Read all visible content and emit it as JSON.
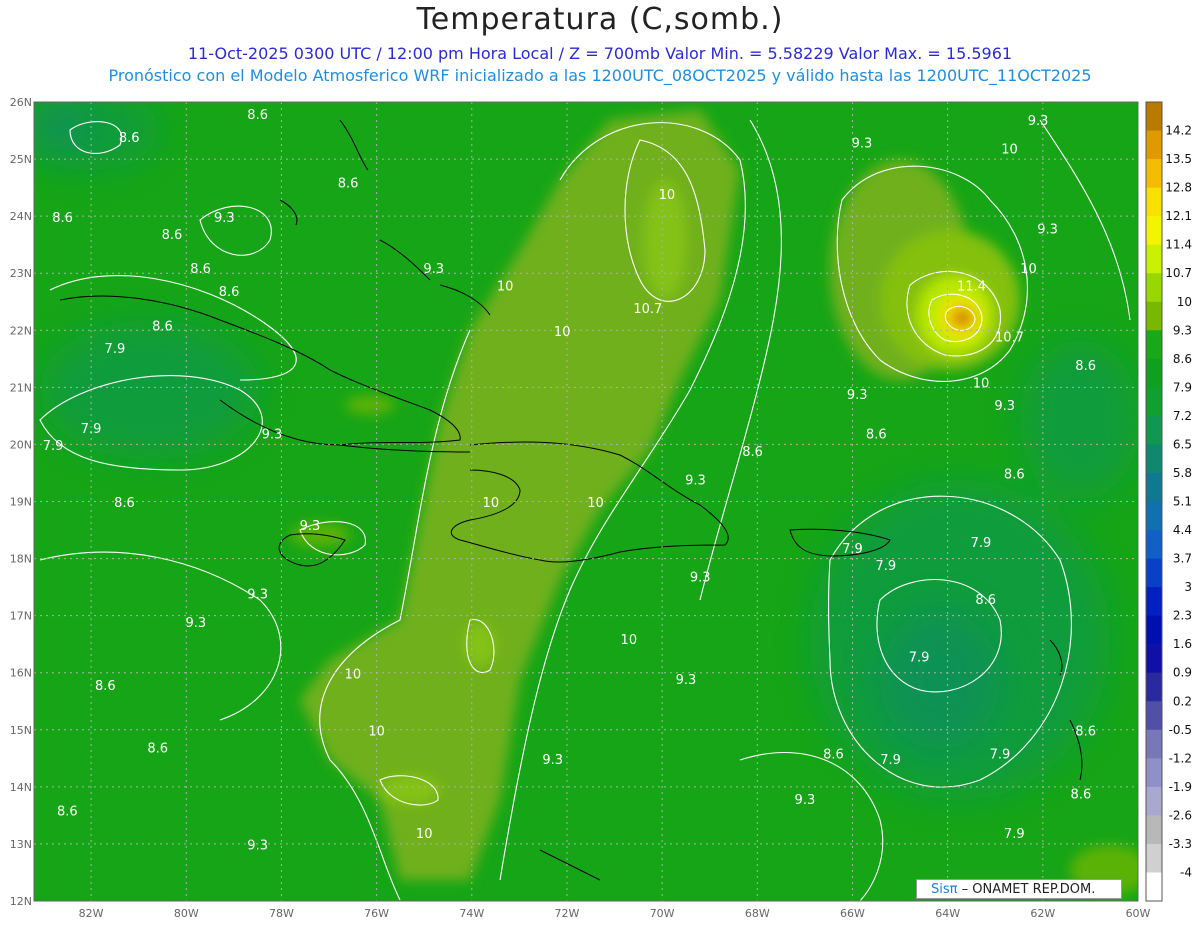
{
  "header": {
    "title": "Temperatura (C,somb.)",
    "line1": "11-Oct-2025  0300 UTC / 12:00 pm Hora Local / Z = 700mb   Valor Min. = 5.58229  Valor Max. = 15.5961",
    "line2": "Pronóstico con el Modelo Atmosferico WRF inicializado a las 1200UTC_08OCT2025 y válido hasta las  1200UTC_11OCT2025"
  },
  "map": {
    "lon_range": [
      -83.2,
      -60
    ],
    "lat_range": [
      12,
      26
    ],
    "lon_ticks": [
      "82W",
      "80W",
      "78W",
      "76W",
      "74W",
      "72W",
      "70W",
      "68W",
      "66W",
      "64W",
      "62W",
      "60W"
    ],
    "lat_ticks": [
      "12N",
      "13N",
      "14N",
      "15N",
      "16N",
      "17N",
      "18N",
      "19N",
      "20N",
      "21N",
      "22N",
      "23N",
      "24N",
      "25N",
      "26N"
    ],
    "contour_labels": [
      {
        "t": "8.6",
        "lon": -81.2,
        "lat": 25.3
      },
      {
        "t": "8.6",
        "lon": -78.5,
        "lat": 25.7
      },
      {
        "t": "8.6",
        "lon": -76.6,
        "lat": 24.5
      },
      {
        "t": "8.6",
        "lon": -82.6,
        "lat": 23.9
      },
      {
        "t": "8.6",
        "lon": -80.3,
        "lat": 23.6
      },
      {
        "t": "9.3",
        "lon": -79.2,
        "lat": 23.9
      },
      {
        "t": "8.6",
        "lon": -79.7,
        "lat": 23.0
      },
      {
        "t": "8.6",
        "lon": -79.1,
        "lat": 22.6
      },
      {
        "t": "8.6",
        "lon": -80.5,
        "lat": 22.0
      },
      {
        "t": "7.9",
        "lon": -81.5,
        "lat": 21.6
      },
      {
        "t": "7.9",
        "lon": -82.0,
        "lat": 20.2
      },
      {
        "t": "7.9",
        "lon": -82.8,
        "lat": 19.9
      },
      {
        "t": "9.3",
        "lon": -78.2,
        "lat": 20.1
      },
      {
        "t": "8.6",
        "lon": -81.3,
        "lat": 18.9
      },
      {
        "t": "9.3",
        "lon": -77.4,
        "lat": 18.5
      },
      {
        "t": "9.3",
        "lon": -78.5,
        "lat": 17.3
      },
      {
        "t": "9.3",
        "lon": -79.8,
        "lat": 16.8
      },
      {
        "t": "8.6",
        "lon": -81.7,
        "lat": 15.7
      },
      {
        "t": "8.6",
        "lon": -80.6,
        "lat": 14.6
      },
      {
        "t": "8.6",
        "lon": -82.5,
        "lat": 13.5
      },
      {
        "t": "9.3",
        "lon": -78.5,
        "lat": 12.9
      },
      {
        "t": "10",
        "lon": -76.5,
        "lat": 15.9
      },
      {
        "t": "10",
        "lon": -76.0,
        "lat": 14.9
      },
      {
        "t": "10",
        "lon": -75.0,
        "lat": 13.1
      },
      {
        "t": "9.3",
        "lon": -74.8,
        "lat": 23.0
      },
      {
        "t": "10",
        "lon": -73.3,
        "lat": 22.7
      },
      {
        "t": "10.7",
        "lon": -70.3,
        "lat": 22.3
      },
      {
        "t": "10",
        "lon": -72.1,
        "lat": 21.9
      },
      {
        "t": "10",
        "lon": -69.9,
        "lat": 24.3
      },
      {
        "t": "9.3",
        "lon": -69.3,
        "lat": 19.3
      },
      {
        "t": "10",
        "lon": -73.6,
        "lat": 18.9
      },
      {
        "t": "10",
        "lon": -71.4,
        "lat": 18.9
      },
      {
        "t": "9.3",
        "lon": -69.2,
        "lat": 17.6
      },
      {
        "t": "10",
        "lon": -70.7,
        "lat": 16.5
      },
      {
        "t": "9.3",
        "lon": -69.5,
        "lat": 15.8
      },
      {
        "t": "9.3",
        "lon": -72.3,
        "lat": 14.4
      },
      {
        "t": "9.3",
        "lon": -67.0,
        "lat": 13.7
      },
      {
        "t": "8.6",
        "lon": -68.1,
        "lat": 19.8
      },
      {
        "t": "8.6",
        "lon": -65.5,
        "lat": 20.1
      },
      {
        "t": "9.3",
        "lon": -65.9,
        "lat": 20.8
      },
      {
        "t": "9.3",
        "lon": -65.8,
        "lat": 25.2
      },
      {
        "t": "9.3",
        "lon": -62.1,
        "lat": 25.6
      },
      {
        "t": "10",
        "lon": -62.7,
        "lat": 25.1
      },
      {
        "t": "9.3",
        "lon": -61.9,
        "lat": 23.7
      },
      {
        "t": "10",
        "lon": -62.3,
        "lat": 23.0
      },
      {
        "t": "11.4",
        "lon": -63.5,
        "lat": 22.7
      },
      {
        "t": "10.7",
        "lon": -62.7,
        "lat": 21.8
      },
      {
        "t": "10",
        "lon": -63.3,
        "lat": 21.0
      },
      {
        "t": "9.3",
        "lon": -62.8,
        "lat": 20.6
      },
      {
        "t": "8.6",
        "lon": -61.1,
        "lat": 21.3
      },
      {
        "t": "8.6",
        "lon": -62.6,
        "lat": 19.4
      },
      {
        "t": "7.9",
        "lon": -66.0,
        "lat": 18.1
      },
      {
        "t": "7.9",
        "lon": -65.3,
        "lat": 17.8
      },
      {
        "t": "7.9",
        "lon": -63.3,
        "lat": 18.2
      },
      {
        "t": "8.6",
        "lon": -63.2,
        "lat": 17.2
      },
      {
        "t": "7.9",
        "lon": -64.6,
        "lat": 16.2
      },
      {
        "t": "8.6",
        "lon": -61.1,
        "lat": 14.9
      },
      {
        "t": "8.6",
        "lon": -66.4,
        "lat": 14.5
      },
      {
        "t": "7.9",
        "lon": -65.2,
        "lat": 14.4
      },
      {
        "t": "7.9",
        "lon": -62.9,
        "lat": 14.5
      },
      {
        "t": "8.6",
        "lon": -61.2,
        "lat": 13.8
      },
      {
        "t": "7.9",
        "lon": -62.6,
        "lat": 13.1
      }
    ]
  },
  "colorbar": {
    "labels": [
      "14.2",
      "13.5",
      "12.8",
      "12.1",
      "11.4",
      "10.7",
      "10",
      "9.3",
      "8.6",
      "7.9",
      "7.2",
      "6.5",
      "5.8",
      "5.1",
      "4.4",
      "3.7",
      "3",
      "2.3",
      "1.6",
      "0.9",
      "0.2",
      "-0.5",
      "-1.2",
      "-1.9",
      "-2.6",
      "-3.3",
      "-4"
    ],
    "colors": [
      "#b87a00",
      "#e09a00",
      "#f4bc00",
      "#f8e000",
      "#f4f400",
      "#c8f000",
      "#98d800",
      "#78b800",
      "#18a818",
      "#10a020",
      "#10a030",
      "#109850",
      "#108870",
      "#107890",
      "#1070b0",
      "#1060c8",
      "#0a40c8",
      "#0020c0",
      "#0010b0",
      "#1010a8",
      "#2a2aa0",
      "#5050a8",
      "#7878b8",
      "#9090c8",
      "#a8a8d0",
      "#b8b8b8",
      "#d0d0d0",
      "#ffffff"
    ]
  },
  "credit": {
    "sis": "Sisπ",
    "rest": "– ONAMET   REP.DOM."
  }
}
